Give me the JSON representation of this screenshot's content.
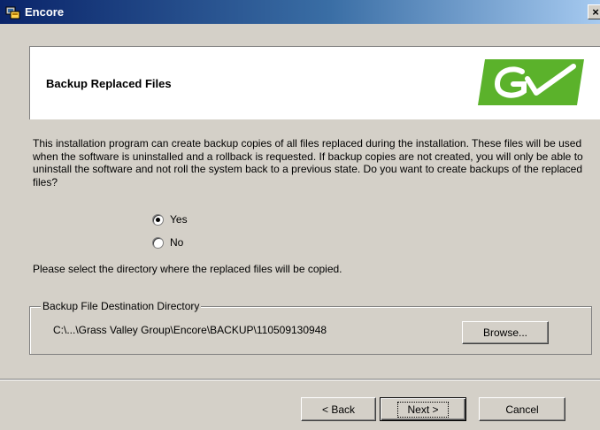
{
  "window": {
    "title": "Encore",
    "close_glyph": "×"
  },
  "header": {
    "title": "Backup Replaced Files",
    "logo": "grass-valley-logo",
    "logo_color": "#5bb22b"
  },
  "body_text": "This installation program can create backup copies of all files replaced during the installation. These files will be used when the software is uninstalled and a rollback is requested.  If backup copies are not created, you will only be able to uninstall the software and not roll the system back to a previous state. Do you want to create backups of the replaced files?",
  "options": {
    "yes": {
      "label": "Yes",
      "checked": true
    },
    "no": {
      "label": "No",
      "checked": false
    }
  },
  "select_dir_text": "Please select the directory where the replaced  files will be copied.",
  "destination": {
    "legend": "Backup File Destination Directory",
    "path": "C:\\...\\Grass Valley Group\\Encore\\BACKUP\\110509130948",
    "browse_label": "Browse..."
  },
  "buttons": {
    "back": "< Back",
    "next": "Next >",
    "cancel": "Cancel"
  },
  "colors": {
    "titlebar_start": "#0a246a",
    "face": "#d4d0c8"
  }
}
